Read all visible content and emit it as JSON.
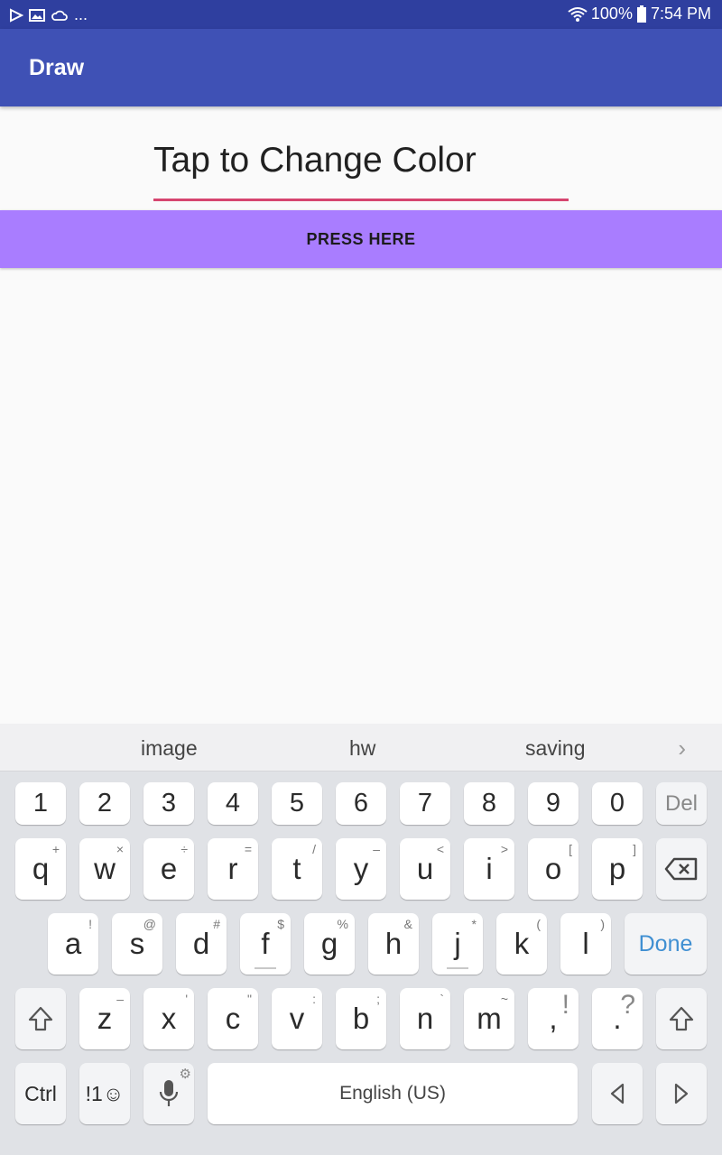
{
  "status": {
    "battery": "100%",
    "time": "7:54 PM",
    "left_icons": [
      "play-store-icon",
      "image-icon",
      "cloud-icon"
    ],
    "more": "..."
  },
  "appbar": {
    "title": "Draw"
  },
  "editor": {
    "value": "Tap to Change Color"
  },
  "button": {
    "label": "PRESS HERE"
  },
  "suggestions": [
    "image",
    "hw",
    "saving"
  ],
  "keyboard": {
    "numbers": [
      "1",
      "2",
      "3",
      "4",
      "5",
      "6",
      "7",
      "8",
      "9",
      "0"
    ],
    "del": "Del",
    "row1": [
      {
        "k": "q",
        "s": "+"
      },
      {
        "k": "w",
        "s": "×"
      },
      {
        "k": "e",
        "s": "÷"
      },
      {
        "k": "r",
        "s": "="
      },
      {
        "k": "t",
        "s": "/"
      },
      {
        "k": "y",
        "s": "–"
      },
      {
        "k": "u",
        "s": "<"
      },
      {
        "k": "i",
        "s": ">"
      },
      {
        "k": "o",
        "s": "["
      },
      {
        "k": "p",
        "s": "]"
      }
    ],
    "row2": [
      {
        "k": "a",
        "s": "!"
      },
      {
        "k": "s",
        "s": "@"
      },
      {
        "k": "d",
        "s": "#"
      },
      {
        "k": "f",
        "s": "$"
      },
      {
        "k": "g",
        "s": "%"
      },
      {
        "k": "h",
        "s": "&"
      },
      {
        "k": "j",
        "s": "*"
      },
      {
        "k": "k",
        "s": "("
      },
      {
        "k": "l",
        "s": ")"
      }
    ],
    "done": "Done",
    "row3": [
      {
        "k": "z",
        "s": "–"
      },
      {
        "k": "x",
        "s": "'"
      },
      {
        "k": "c",
        "s": "\""
      },
      {
        "k": "v",
        "s": ":"
      },
      {
        "k": "b",
        "s": ";"
      },
      {
        "k": "n",
        "s": "`"
      },
      {
        "k": "m",
        "s": "~"
      }
    ],
    "comma": ",",
    "comma_sup": "!",
    "period": ".",
    "period_sup": "?",
    "ctrl": "Ctrl",
    "symbols": "!1☺",
    "space": "English (US)"
  }
}
